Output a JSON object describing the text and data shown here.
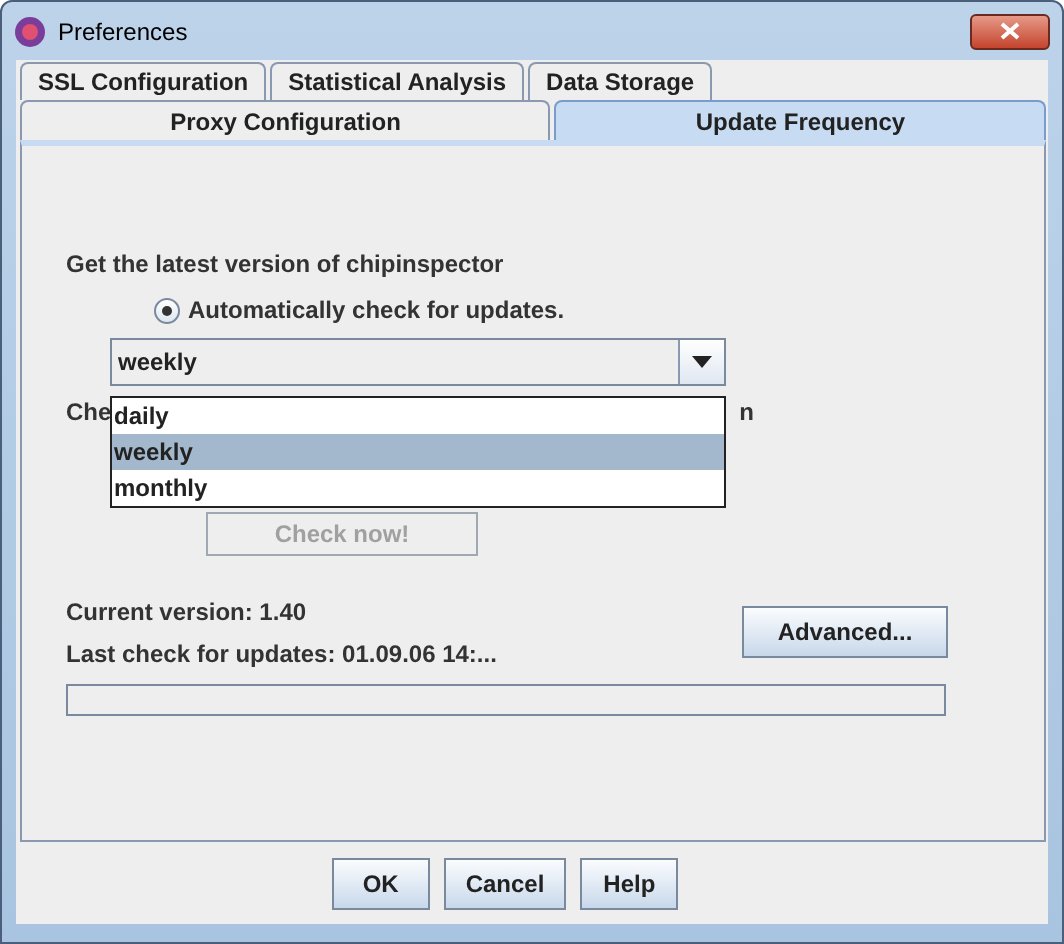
{
  "window": {
    "title": "Preferences"
  },
  "tabs": [
    [
      {
        "label": "SSL Configuration",
        "selected": false
      },
      {
        "label": "Statistical Analysis",
        "selected": false
      },
      {
        "label": "Data Storage",
        "selected": false
      }
    ],
    [
      {
        "label": "Proxy Configuration",
        "selected": false
      },
      {
        "label": "Update Frequency",
        "selected": true
      }
    ]
  ],
  "heading": "Get the latest version of chipinspector",
  "auto_check": {
    "label": "Automatically check for updates.",
    "selected": true
  },
  "frequency": {
    "value": "weekly",
    "expanded": true,
    "options": [
      {
        "label": "daily",
        "selected": false
      },
      {
        "label": "weekly",
        "selected": true
      },
      {
        "label": "monthly",
        "selected": false
      }
    ]
  },
  "hidden_line": {
    "start": "Che",
    "end": "n"
  },
  "check_now": {
    "label": "Check now!",
    "disabled": true
  },
  "current_version": "Current version: 1.40",
  "last_check": "Last check for updates: 01.09.06 14:...",
  "advanced": "Advanced...",
  "progress": {
    "level": 0
  },
  "buttons": [
    "OK",
    "Cancel",
    "Help"
  ]
}
